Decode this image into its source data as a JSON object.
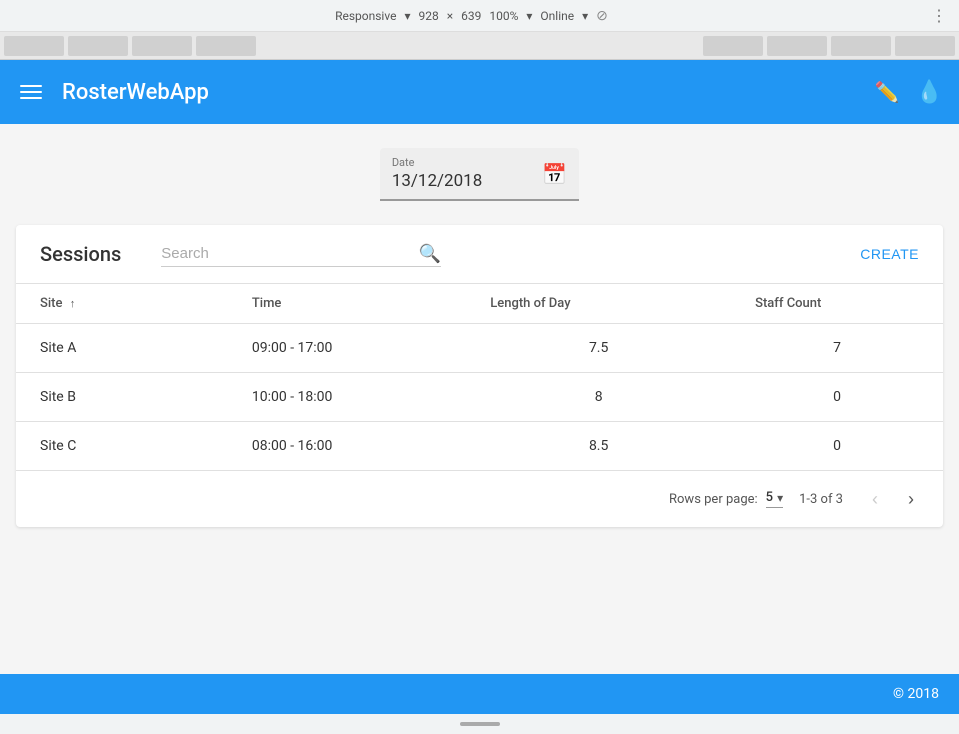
{
  "browser": {
    "responsive_label": "Responsive",
    "width": "928",
    "separator": "×",
    "height": "639",
    "zoom": "100%",
    "status": "Online",
    "more_icon": "⋮"
  },
  "app": {
    "title": "RosterWebApp",
    "footer_copyright": "© 2018"
  },
  "date_picker": {
    "label": "Date",
    "value": "13/12/2018"
  },
  "sessions": {
    "title": "Sessions",
    "search_placeholder": "Search",
    "create_label": "CREATE",
    "columns": {
      "site": "Site",
      "time": "Time",
      "length_of_day": "Length of Day",
      "staff_count": "Staff Count"
    },
    "rows": [
      {
        "site": "Site A",
        "time": "09:00 - 17:00",
        "length": "7.5",
        "staff": "7"
      },
      {
        "site": "Site B",
        "time": "10:00 - 18:00",
        "length": "8",
        "staff": "0"
      },
      {
        "site": "Site C",
        "time": "08:00 - 16:00",
        "length": "8.5",
        "staff": "0"
      }
    ],
    "pagination": {
      "rows_per_page_label": "Rows per page:",
      "rows_per_page_value": "5",
      "page_info": "1-3 of 3"
    }
  }
}
